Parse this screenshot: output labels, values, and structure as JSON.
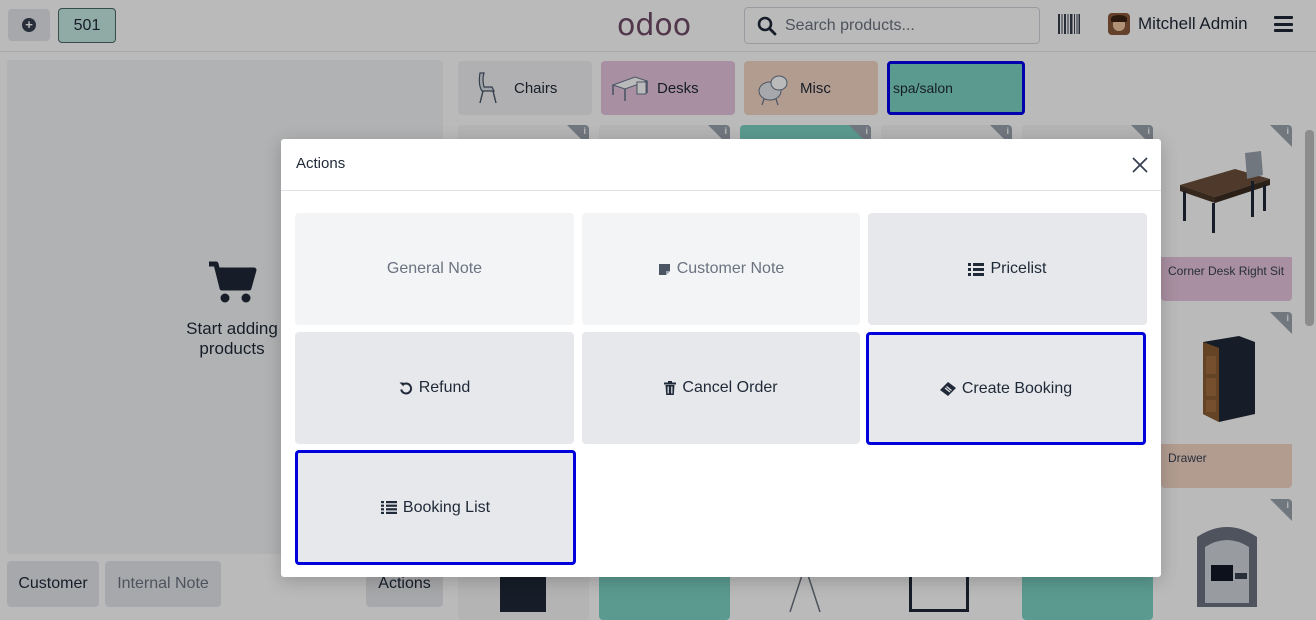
{
  "topbar": {
    "order_number": "501",
    "logo": "odoo",
    "search_placeholder": "Search products...",
    "user_name": "Mitchell Admin"
  },
  "left": {
    "empty_title": "Start adding products",
    "customer_label": "Customer",
    "internal_note_label": "Internal Note",
    "actions_label": "Actions"
  },
  "categories": [
    {
      "label": "Chairs",
      "color": "#f1f2f4"
    },
    {
      "label": "Desks",
      "color": "#e7c4dd"
    },
    {
      "label": "Misc",
      "color": "#f5d6c6"
    },
    {
      "label": "spa/salon",
      "color": "#7dd3c4"
    }
  ],
  "products": [
    {
      "name": "Corner Desk Right Sit"
    },
    {
      "name": "Drawer"
    }
  ],
  "modal": {
    "title": "Actions",
    "buttons": [
      {
        "label": "General Note",
        "icon": "none",
        "disabled": true
      },
      {
        "label": "Customer Note",
        "icon": "note-icon",
        "disabled": true
      },
      {
        "label": "Pricelist",
        "icon": "list-icon"
      },
      {
        "label": "Refund",
        "icon": "undo-icon"
      },
      {
        "label": "Cancel Order",
        "icon": "trash-icon"
      },
      {
        "label": "Create Booking",
        "icon": "ticket-icon"
      },
      {
        "label": "Booking List",
        "icon": "list-icon"
      }
    ]
  },
  "colors": {
    "brand": "#714B67",
    "highlight": "#0000dd",
    "spa_teal": "#7dd3c4"
  }
}
